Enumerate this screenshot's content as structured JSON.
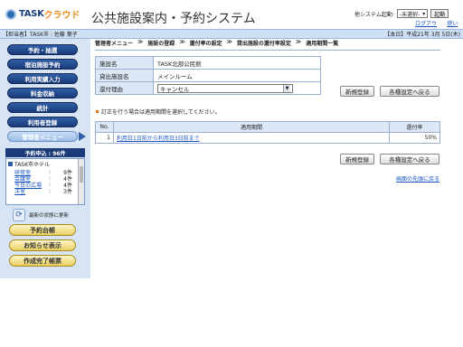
{
  "header": {
    "brand_main": "TASK",
    "brand_sub": "クラウド",
    "app_title": "公共施設案内・予約システム",
    "system_label": "他システム起動:",
    "system_select": "-未選択-",
    "launch_button": "起動",
    "logout_link": "ログアウト",
    "help_link": "使い方"
  },
  "statusbar": {
    "user": "【担当者】TASK市 : 佐藤 葉子",
    "date": "【本日】平成21年 3月 5日(木)"
  },
  "sidebar": {
    "menu": [
      "予約・抽選",
      "宿泊施設予約",
      "利用実績入力",
      "料金収納",
      "統計",
      "利用者登録",
      "管理者メニュー"
    ],
    "reservation_header": "予約申込 : 96件",
    "facility": "TASK市ホテル",
    "rooms": [
      {
        "name": "研修室",
        "count": "9件"
      },
      {
        "name": "会議室",
        "count": "4件"
      },
      {
        "name": "今日の広場",
        "count": "4件"
      },
      {
        "name": "洋室",
        "count": "3件"
      }
    ],
    "refresh_label": "最新の状態に更新",
    "ledger_button": "予約台帳",
    "notice_button": "お知らせ表示",
    "report_button": "作成完了帳票"
  },
  "breadcrumb": [
    "管理者メニュー",
    "施設の登録",
    "還付率の設定",
    "貸出施設の還付率設定",
    "適用期間一覧"
  ],
  "form": {
    "facility_label": "施設名",
    "facility_value": "TASK北部公民館",
    "room_label": "貸出施設名",
    "room_value": "メインルーム",
    "reason_label": "還付理由",
    "reason_value": "キャンセル"
  },
  "buttons": {
    "new": "新規登録",
    "back_settings": "各種設定へ戻る"
  },
  "note": "訂正を行う場合は適用期間を選択してください。",
  "table": {
    "headers": [
      "No.",
      "適用期間",
      "還付率"
    ],
    "rows": [
      {
        "no": "1",
        "period": "利用日1日前から利用日3日前まで",
        "rate": "50%"
      }
    ]
  },
  "pagetop": "画面の先頭に戻る"
}
